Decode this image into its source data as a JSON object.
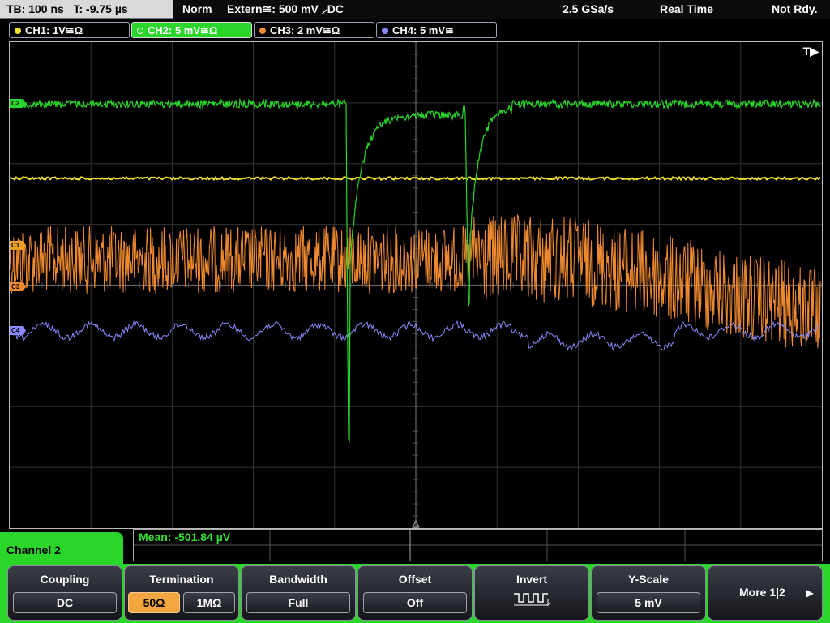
{
  "topbar": {
    "timebase": "TB: 100 ns",
    "trigger_time": "T: -9.75 µs",
    "mode": "Norm",
    "trigger_source": "Extern≅: 500 mV ⸝DC",
    "sample_rate": "2.5 GSa/s",
    "acq_mode": "Real Time",
    "status": "Not Rdy."
  },
  "channels": [
    {
      "label": "CH1: 1V≅Ω",
      "color": "#f0e030",
      "active": false
    },
    {
      "label": "CH2: 5 mV≅Ω",
      "color": "#29d629",
      "active": true
    },
    {
      "label": "CH3: 2 mV≅Ω",
      "color": "#f08a30",
      "active": false
    },
    {
      "label": "CH4: 5 mV≅",
      "color": "#8a8aff",
      "active": false
    }
  ],
  "screen": {
    "trigger_marker": "T▶",
    "markers": [
      {
        "label": "C2",
        "color": "#29d629"
      },
      {
        "label": "C1",
        "color": "#f0a020"
      },
      {
        "label": "C3",
        "color": "#f08a30"
      },
      {
        "label": "C4",
        "color": "#8a8aff"
      }
    ]
  },
  "measure": {
    "mean": "Mean: -501.84 µV"
  },
  "menu": {
    "channel_title": "Channel 2",
    "coupling": {
      "title": "Coupling",
      "value": "DC"
    },
    "termination": {
      "title": "Termination",
      "opt1": "50Ω",
      "opt2": "1MΩ"
    },
    "bandwidth": {
      "title": "Bandwidth",
      "value": "Full"
    },
    "offset": {
      "title": "Offset",
      "value": "Off"
    },
    "invert": {
      "title": "Invert"
    },
    "yscale": {
      "title": "Y-Scale",
      "value": "5 mV"
    },
    "more": {
      "title": "More 1|2"
    }
  },
  "colors": {
    "ch1": "#f0e030",
    "ch2": "#29d629",
    "ch3": "#f08a30",
    "ch4": "#8a8aff",
    "accent": "#29d629",
    "selected": "#f3a53f"
  }
}
